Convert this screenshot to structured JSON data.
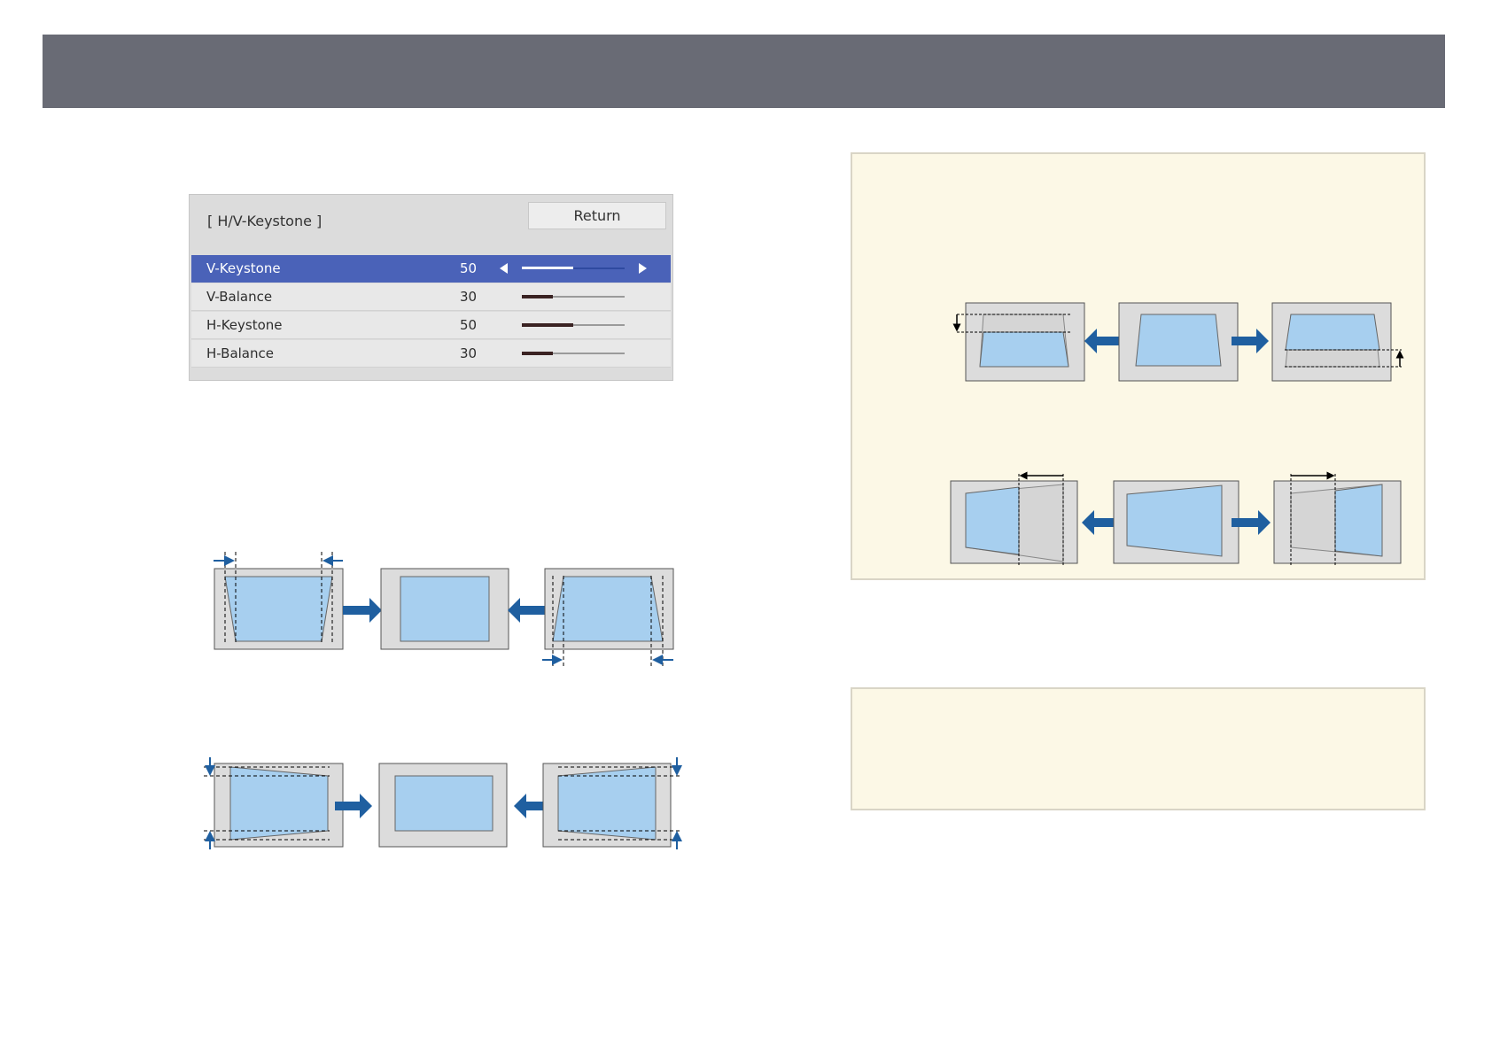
{
  "osd": {
    "title": "[ H/V-Keystone ]",
    "return_label": "Return",
    "rows": [
      {
        "label": "V-Keystone",
        "value": "50",
        "level": 0.5,
        "selected": true
      },
      {
        "label": "V-Balance",
        "value": "30",
        "level": 0.3,
        "selected": false
      },
      {
        "label": "H-Keystone",
        "value": "50",
        "level": 0.5,
        "selected": false
      },
      {
        "label": "H-Balance",
        "value": "30",
        "level": 0.3,
        "selected": false
      }
    ]
  },
  "colors": {
    "header": "#696b75",
    "selection": "#4a62b8",
    "image_fill": "#a7cfef",
    "screen_fill": "#dcdcdc",
    "arrow": "#1f5fa0",
    "note_bg": "#fcf8e6"
  },
  "icons": [
    "left-triangle-icon",
    "right-triangle-icon",
    "arrow-right-icon",
    "arrow-left-icon"
  ]
}
